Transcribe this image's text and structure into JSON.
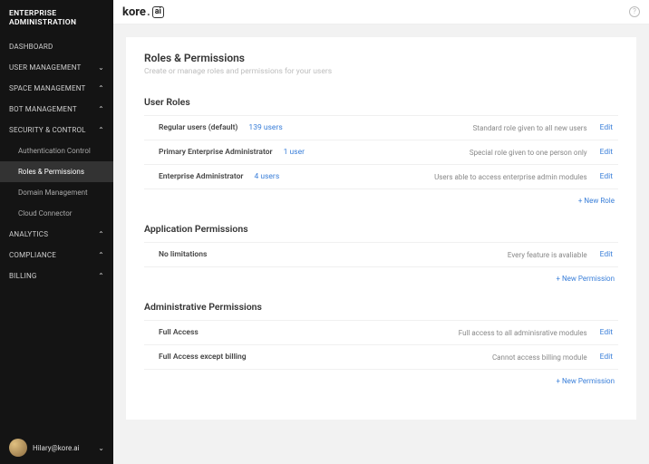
{
  "app_title": "ENTERPRISE ADMINISTRATION",
  "logo": {
    "text": "kore",
    "suffix": "ai"
  },
  "nav": [
    {
      "label": "DASHBOARD",
      "expandable": false
    },
    {
      "label": "USER MANAGEMENT",
      "expandable": true,
      "open": false
    },
    {
      "label": "SPACE MANAGEMENT",
      "expandable": true,
      "open": true
    },
    {
      "label": "BOT MANAGEMENT",
      "expandable": true,
      "open": true
    },
    {
      "label": "SECURITY & CONTROL",
      "expandable": true,
      "open": true,
      "children": [
        {
          "label": "Authentication Control",
          "active": false
        },
        {
          "label": "Roles & Permissions",
          "active": true
        },
        {
          "label": "Domain Management",
          "active": false
        },
        {
          "label": "Cloud Connector",
          "active": false
        }
      ]
    },
    {
      "label": "ANALYTICS",
      "expandable": true,
      "open": true
    },
    {
      "label": "COMPLIANCE",
      "expandable": true,
      "open": true
    },
    {
      "label": "BILLING",
      "expandable": true,
      "open": true
    }
  ],
  "user": {
    "name": "Hilary@kore.ai"
  },
  "page": {
    "title": "Roles & Permissions",
    "subtitle": "Create or manage roles and permissions for your users"
  },
  "sections": {
    "user_roles": {
      "title": "User Roles",
      "rows": [
        {
          "name": "Regular users (default)",
          "count": "139 users",
          "desc": "Standard role given to all new users",
          "edit": "Edit"
        },
        {
          "name": "Primary Enterprise Administrator",
          "count": "1 user",
          "desc": "Special role given to one person only",
          "edit": "Edit"
        },
        {
          "name": "Enterprise Administrator",
          "count": "4 users",
          "desc": "Users able to access enterprise admin modules",
          "edit": "Edit"
        }
      ],
      "add": "+ New Role"
    },
    "app_perms": {
      "title": "Application Permissions",
      "rows": [
        {
          "name": "No limitations",
          "count": "",
          "desc": "Every feature is avaliable",
          "edit": "Edit"
        }
      ],
      "add": "+ New Permission"
    },
    "admin_perms": {
      "title": "Administrative Permissions",
      "rows": [
        {
          "name": "Full Access",
          "count": "",
          "desc": "Full access to all adminisrative modules",
          "edit": "Edit"
        },
        {
          "name": "Full Access except billing",
          "count": "",
          "desc": "Cannot access billing module",
          "edit": "Edit"
        }
      ],
      "add": "+ New Permission"
    }
  }
}
